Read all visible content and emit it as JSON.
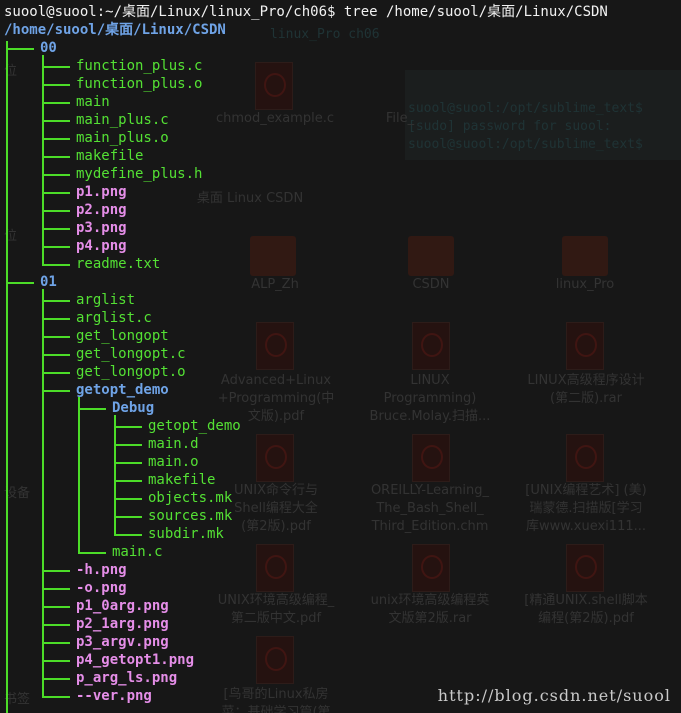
{
  "prompt": {
    "text": "suool@suool:~/桌面/Linux/linux_Pro/ch06$ tree /home/suool/桌面/Linux/CSDN"
  },
  "root_path": "/home/suool/桌面/Linux/CSDN",
  "tree": [
    {
      "depth": 0,
      "name": "00",
      "kind": "dir"
    },
    {
      "depth": 1,
      "name": "function_plus.c",
      "kind": "file"
    },
    {
      "depth": 1,
      "name": "function_plus.o",
      "kind": "file"
    },
    {
      "depth": 1,
      "name": "main",
      "kind": "file"
    },
    {
      "depth": 1,
      "name": "main_plus.c",
      "kind": "file"
    },
    {
      "depth": 1,
      "name": "main_plus.o",
      "kind": "file"
    },
    {
      "depth": 1,
      "name": "makefile",
      "kind": "file"
    },
    {
      "depth": 1,
      "name": "mydefine_plus.h",
      "kind": "file"
    },
    {
      "depth": 1,
      "name": "p1.png",
      "kind": "image"
    },
    {
      "depth": 1,
      "name": "p2.png",
      "kind": "image"
    },
    {
      "depth": 1,
      "name": "p3.png",
      "kind": "image"
    },
    {
      "depth": 1,
      "name": "p4.png",
      "kind": "image"
    },
    {
      "depth": 1,
      "name": "readme.txt",
      "kind": "file"
    },
    {
      "depth": 0,
      "name": "01",
      "kind": "dir"
    },
    {
      "depth": 1,
      "name": "arglist",
      "kind": "file"
    },
    {
      "depth": 1,
      "name": "arglist.c",
      "kind": "file"
    },
    {
      "depth": 1,
      "name": "get_longopt",
      "kind": "file"
    },
    {
      "depth": 1,
      "name": "get_longopt.c",
      "kind": "file"
    },
    {
      "depth": 1,
      "name": "get_longopt.o",
      "kind": "file"
    },
    {
      "depth": 1,
      "name": "getopt_demo",
      "kind": "dir"
    },
    {
      "depth": 2,
      "name": "Debug",
      "kind": "dir"
    },
    {
      "depth": 3,
      "name": "getopt_demo",
      "kind": "file"
    },
    {
      "depth": 3,
      "name": "main.d",
      "kind": "file"
    },
    {
      "depth": 3,
      "name": "main.o",
      "kind": "file"
    },
    {
      "depth": 3,
      "name": "makefile",
      "kind": "file"
    },
    {
      "depth": 3,
      "name": "objects.mk",
      "kind": "file"
    },
    {
      "depth": 3,
      "name": "sources.mk",
      "kind": "file"
    },
    {
      "depth": 3,
      "name": "subdir.mk",
      "kind": "file"
    },
    {
      "depth": 2,
      "name": "main.c",
      "kind": "file"
    },
    {
      "depth": 1,
      "name": "-h.png",
      "kind": "image"
    },
    {
      "depth": 1,
      "name": "-o.png",
      "kind": "image"
    },
    {
      "depth": 1,
      "name": "p1_0arg.png",
      "kind": "image"
    },
    {
      "depth": 1,
      "name": "p2_1arg.png",
      "kind": "image"
    },
    {
      "depth": 1,
      "name": "p3_argv.png",
      "kind": "image"
    },
    {
      "depth": 1,
      "name": "p4_getopt1.png",
      "kind": "image"
    },
    {
      "depth": 1,
      "name": "p_arg_ls.png",
      "kind": "image"
    },
    {
      "depth": 1,
      "name": "--ver.png",
      "kind": "image"
    }
  ],
  "background": {
    "title": "linux_Pro ch06",
    "term_lines": [
      "suool@suool:/opt/sublime_text$",
      "[sudo] password for suool:",
      "suool@suool:/opt/sublime_text$"
    ],
    "breadcrumb": "桌面  Linux  CSDN",
    "sidebar": [
      "位",
      "位",
      "设备",
      "书签"
    ],
    "files": [
      "chmod_example.c",
      "File_",
      "ALP_Zh",
      "CSDN",
      "linux_Pro",
      "Advanced+Linux\n+Programming(中\n文版).pdf",
      "LINUX\nProgramming)\nBruce.Molay.扫描...",
      "LINUX高级程序设计\n(第二版).rar",
      "UNIX命令行与\nShell编程大全\n(第2版).pdf",
      "OREILLY-Learning_\nThe_Bash_Shell_\nThird_Edition.chm",
      "[UNIX编程艺术] (美)\n瑞蒙德.扫描版[学习\n库www.xuexi111...",
      "UNIX环境高级编程_\n第二版中文.pdf",
      "unix环境高级编程英\n文版第2版.rar",
      "[精通UNIX.shell脚本\n编程(第2版).pdf",
      "[鸟哥的Linux私房\n菜：基础学习篇(第"
    ]
  },
  "watermark": "http://blog.csdn.net/suool",
  "colors": {
    "prompt": "#f2f2f2",
    "tree_lines": "#4cdc28",
    "file": "#54e134",
    "dir": "#6fa3e6",
    "image": "#e58ee8"
  }
}
